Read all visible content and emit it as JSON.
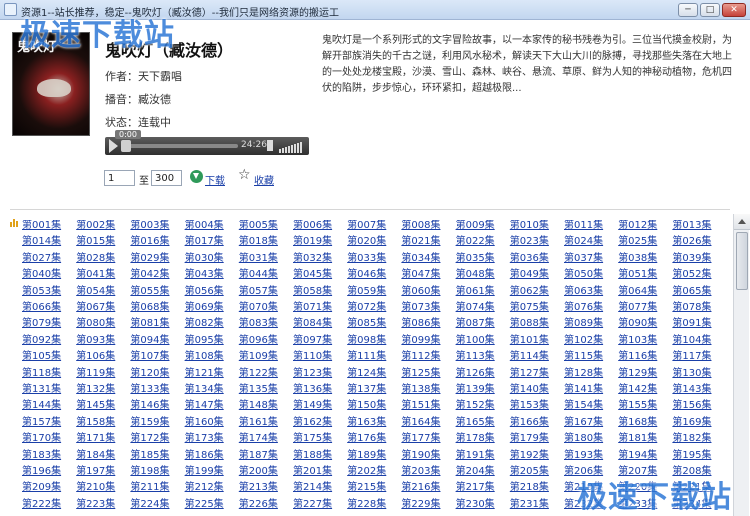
{
  "window": {
    "title": "资源1--站长推荐，稳定--鬼吹灯（臧汝德）--我们只是网络资源的搬运工",
    "min_symbol": "─",
    "max_symbol": "□",
    "close_symbol": "✕"
  },
  "watermark": "极速下载站",
  "book": {
    "cover_text": "鬼吹灯",
    "title": "鬼吹灯（臧汝德）",
    "author": "作者：天下霸唱",
    "narrator": "播音：臧汝德",
    "status": "状态：连载中",
    "description": "鬼吹灯是一个系列形式的文字冒险故事，以一本家传的秘书残卷为引。三位当代摸金校尉，为解开部族消失的千古之谜，利用风水秘术，解读天下大山大川的脉搏，寻找那些失落在大地上的一处处龙楼宝殿，沙漠、雪山、森林、峡谷、悬流、草原、鲜为人知的神秘动植物，危机四伏的陷阱，步步惊心，环环紧扣，超越极限..."
  },
  "player": {
    "elapsed": "0:00",
    "duration": "24:26",
    "progress_fraction": 0.0
  },
  "range": {
    "from": "1",
    "separator": "至",
    "to": "300",
    "download_label": "下载",
    "favorite_label": "收藏"
  },
  "episodes": {
    "prefix": "第",
    "suffix": "集",
    "first": 1,
    "last": 234,
    "columns": 13
  }
}
